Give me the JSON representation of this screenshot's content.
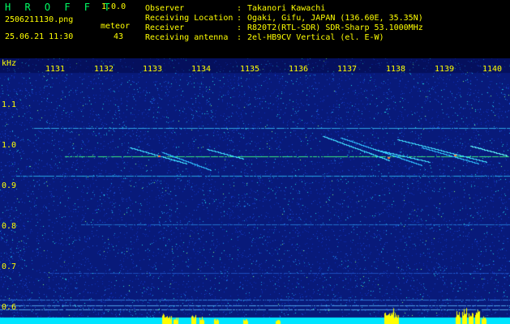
{
  "app": {
    "name": "H R O F F T",
    "version": "1.0.0"
  },
  "file": {
    "filename": "2506211130.png",
    "datetime": "25.06.21 11:30",
    "mode_label": "meteor",
    "count": "43"
  },
  "info": {
    "observer_label": "Observer",
    "observer_value": "Takanori Kawachi",
    "location_label": "Receiving Location",
    "location_value": "Ogaki, Gifu, JAPAN (136.60E, 35.35N)",
    "receiver_label": "Receiver",
    "receiver_value": "R820T2(RTL-SDR) SDR-Sharp 53.1000MHz",
    "antenna_label": "Receiving antenna",
    "antenna_value": "2el-HB9CV Vertical (el. E-W)",
    "sep": ":"
  },
  "axes": {
    "y_unit": "kHz",
    "x_ticks": [
      "1131",
      "1132",
      "1133",
      "1134",
      "1135",
      "1136",
      "1137",
      "1138",
      "1139",
      "1140"
    ],
    "y_ticks": [
      "1.1",
      "1.0",
      "0.9",
      "0.8",
      "0.7",
      "0.6"
    ]
  },
  "colors": {
    "label": "#ffff00",
    "logo": "#00ff66",
    "background_noise": "#0a1a8a",
    "trace": "#00e0ff",
    "bottom_bar": "#00e5ff"
  }
}
